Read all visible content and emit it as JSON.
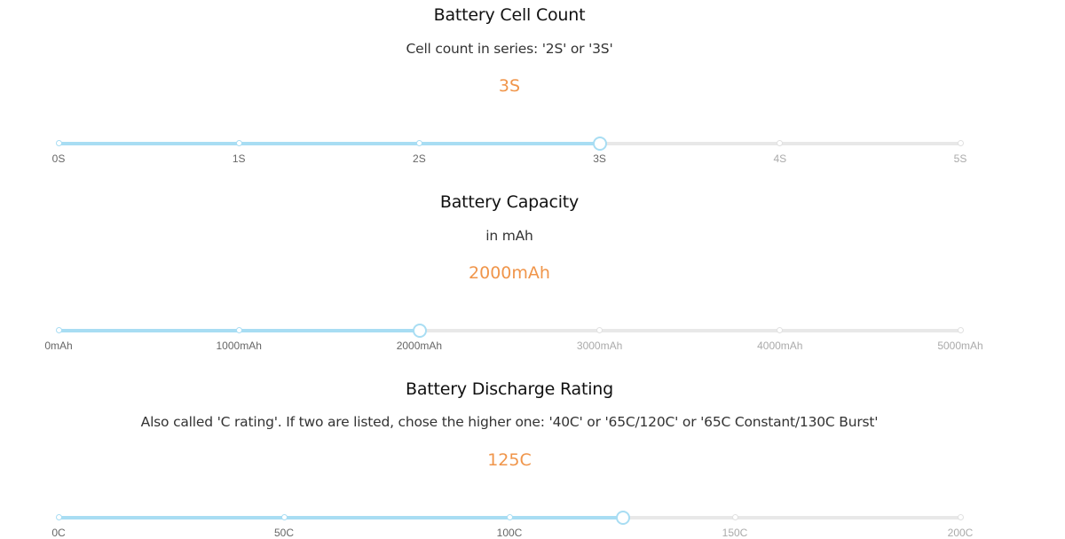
{
  "sliders": [
    {
      "title": "Battery Cell Count",
      "description": "Cell count in series: '2S' or '3S'",
      "value": "3S",
      "selected_index": 3,
      "ticks": [
        "0S",
        "1S",
        "2S",
        "3S",
        "4S",
        "5S"
      ]
    },
    {
      "title": "Battery Capacity",
      "description": "in mAh",
      "value": "2000mAh",
      "selected_index": 2,
      "ticks": [
        "0mAh",
        "1000mAh",
        "2000mAh",
        "3000mAh",
        "4000mAh",
        "5000mAh"
      ]
    },
    {
      "title": "Battery Discharge Rating",
      "description": "Also called 'C rating'. If two are listed, chose the higher one: '40C' or '65C/120C' or '65C Constant/130C Burst'",
      "value": "125C",
      "selected_value": 125,
      "range": [
        0,
        200
      ],
      "ticks": [
        "0C",
        "50C",
        "100C",
        "150C",
        "200C"
      ]
    }
  ],
  "colors": {
    "accent": "#a8ddf3",
    "value": "#f0954a",
    "track": "#e8e8e8"
  }
}
